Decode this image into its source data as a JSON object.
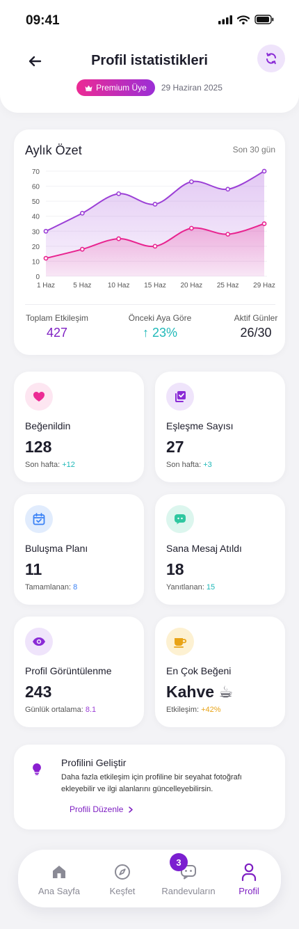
{
  "status_bar": {
    "time": "09:41"
  },
  "header": {
    "title": "Profil istatistikleri",
    "badge": "Premium Üye",
    "date": "29 Haziran 2025"
  },
  "summary": {
    "title": "Aylık Özet",
    "range": "Son 30 gün",
    "stats": [
      {
        "label": "Toplam Etkileşim",
        "value": "427",
        "color": "#7e1fc2"
      },
      {
        "label": "Önceki Aya Göre",
        "value": "↑ 23%",
        "color": "#1fb8b8"
      },
      {
        "label": "Aktif Günler",
        "value": "26/30",
        "color": "#1d1d2b"
      }
    ]
  },
  "chart_data": {
    "type": "area",
    "x": [
      "1 Haz",
      "5 Haz",
      "10 Haz",
      "15 Haz",
      "20 Haz",
      "25 Haz",
      "29 Haz"
    ],
    "yticks": [
      0,
      10,
      20,
      30,
      40,
      50,
      60,
      70
    ],
    "ylim": [
      0,
      70
    ],
    "grid": true,
    "series": [
      {
        "values": [
          30,
          42,
          55,
          48,
          63,
          58,
          70
        ],
        "color": "#9b3fd6"
      },
      {
        "values": [
          12,
          18,
          25,
          20,
          32,
          28,
          35
        ],
        "color": "#e8238f"
      }
    ]
  },
  "tiles": [
    {
      "label": "Beğenildin",
      "value": "128",
      "sub_label": "Son hafta:",
      "sub_value": "+12",
      "sub_color": "#1fb8b8",
      "icon": "heart-icon",
      "icon_bg": "#fde6f1",
      "icon_color": "#ec2b94"
    },
    {
      "label": "Eşleşme Sayısı",
      "value": "27",
      "sub_label": "Son hafta:",
      "sub_value": "+3",
      "sub_color": "#1fb8b8",
      "icon": "match-icon",
      "icon_bg": "#efe4fb",
      "icon_color": "#8a2bd6"
    },
    {
      "label": "Buluşma Planı",
      "value": "11",
      "sub_label": "Tamamlanan:",
      "sub_value": "8",
      "sub_color": "#3b82f6",
      "icon": "calendar-check-icon",
      "icon_bg": "#e1ecfd",
      "icon_color": "#3b82f6"
    },
    {
      "label": "Sana Mesaj Atıldı",
      "value": "18",
      "sub_label": "Yanıtlanan:",
      "sub_value": "15",
      "sub_color": "#1fb8b8",
      "icon": "chat-icon",
      "icon_bg": "#dcf6ee",
      "icon_color": "#2fc7a0"
    },
    {
      "label": "Profil Görüntülenme",
      "value": "243",
      "sub_label": "Günlük ortalama:",
      "sub_value": "8.1",
      "sub_color": "#9b3fd6",
      "icon": "eye-icon",
      "icon_bg": "#efe4fb",
      "icon_color": "#8a2bd6"
    },
    {
      "label": "En Çok Beğeni",
      "value": "Kahve ☕",
      "sub_label": "Etkileşim:",
      "sub_value": "+42%",
      "sub_color": "#e8a317",
      "icon": "coffee-icon",
      "icon_bg": "#fdf1d2",
      "icon_color": "#e8a317"
    }
  ],
  "tip": {
    "title": "Profilini Geliştir",
    "text": "Daha fazla etkileşim için profiline bir seyahat fotoğrafı ekleyebilir ve ilgi alanlarını güncelleyebilirsin.",
    "link": "Profili Düzenle"
  },
  "nav": {
    "items": [
      {
        "label": "Ana Sayfa",
        "icon": "home-icon",
        "active": false
      },
      {
        "label": "Keşfet",
        "icon": "compass-icon",
        "active": false
      },
      {
        "label": "Randevuların",
        "icon": "chat-bubble-icon",
        "active": false
      },
      {
        "label": "Profil",
        "icon": "user-icon",
        "active": true
      }
    ],
    "badge_count": "3"
  }
}
